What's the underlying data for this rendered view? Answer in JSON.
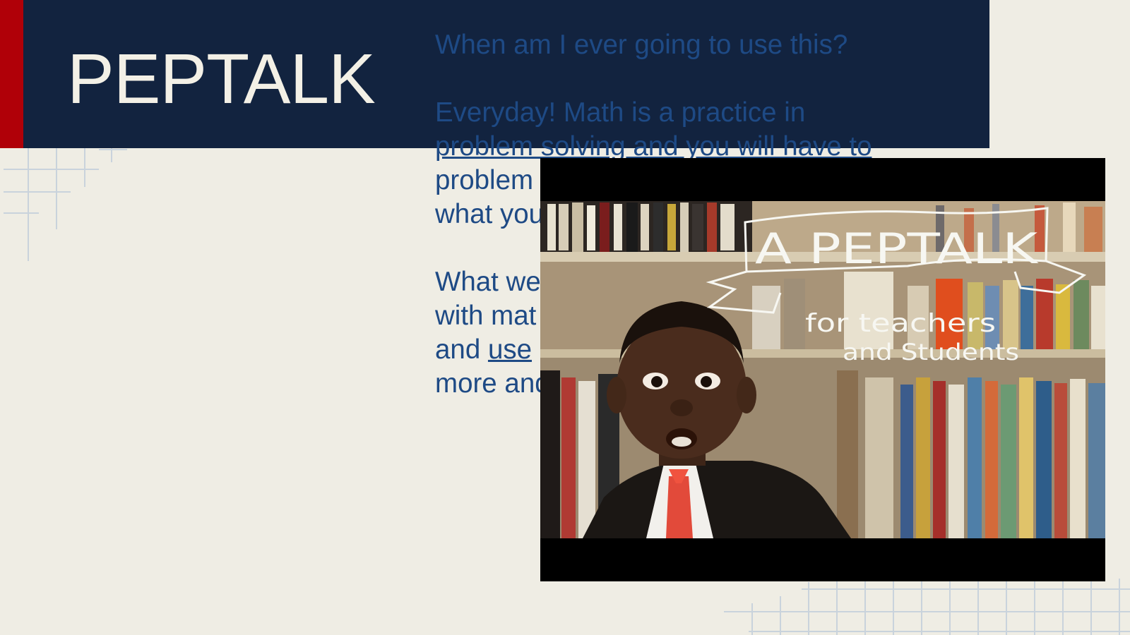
{
  "slide": {
    "title": "PEPTALK",
    "body": {
      "question": "When am I ever going to use this?",
      "answer_lines": [
        "Everyday! Math is a practice in",
        "problem solving and you will have to",
        "problem",
        "what you"
      ],
      "closing_lines": {
        "line1": "What we",
        "line2": "with mat",
        "line3_prefix": "and ",
        "line3_link": "use",
        "line4": "more and"
      }
    },
    "video": {
      "banner_title": "A PEPTALK",
      "subtitle_line1": "for teachers",
      "subtitle_line2": "and Students"
    },
    "colors": {
      "background": "#efede4",
      "title_band": "#12233f",
      "accent": "#b00008",
      "title_text": "#f3f0e6",
      "body_text": "#1e4a85"
    }
  }
}
